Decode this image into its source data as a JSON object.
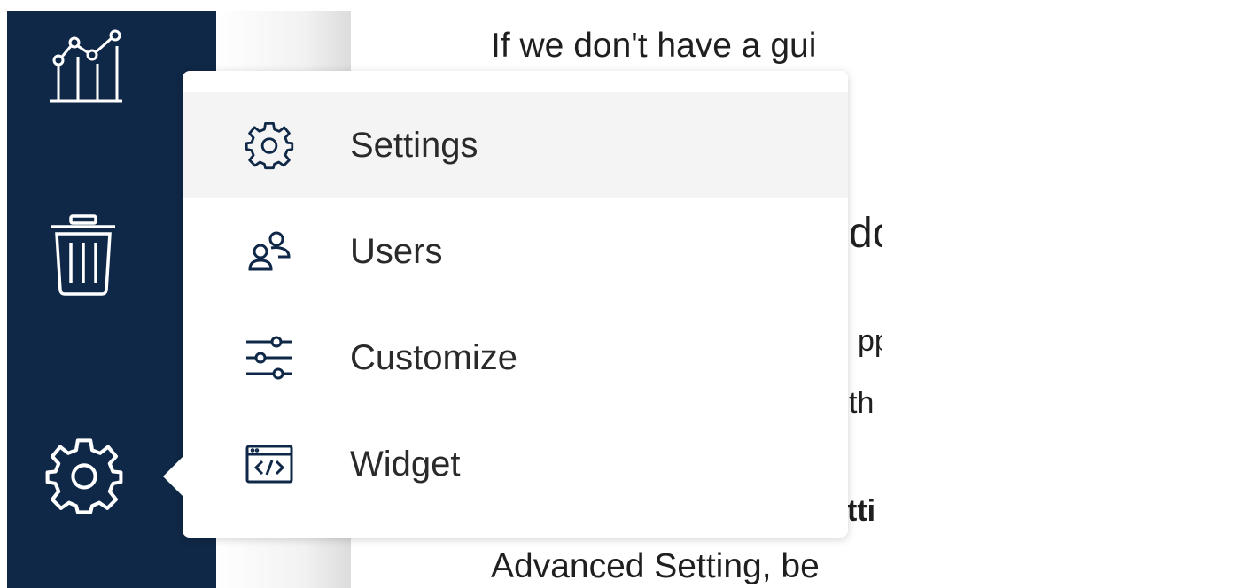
{
  "sidebar": {
    "icons": [
      "analytics-icon",
      "trash-icon",
      "gear-icon"
    ],
    "colors": {
      "background": "#0f2847",
      "icon": "#ffffff"
    }
  },
  "content": {
    "line1": "If we don't have a gui",
    "heading_frag": "dc",
    "frag_pp": "pp",
    "frag_th": "th",
    "frag_bold": "tti",
    "line_bottom": "Advanced Setting, be"
  },
  "menu": {
    "items": [
      {
        "label": "Settings",
        "icon": "gear-icon",
        "active": true
      },
      {
        "label": "Users",
        "icon": "users-icon",
        "active": false
      },
      {
        "label": "Customize",
        "icon": "sliders-icon",
        "active": false
      },
      {
        "label": "Widget",
        "icon": "code-window-icon",
        "active": false
      }
    ],
    "colors": {
      "active_bg": "#f4f4f4",
      "icon": "#0f2847",
      "text": "#2a2a2a"
    }
  }
}
